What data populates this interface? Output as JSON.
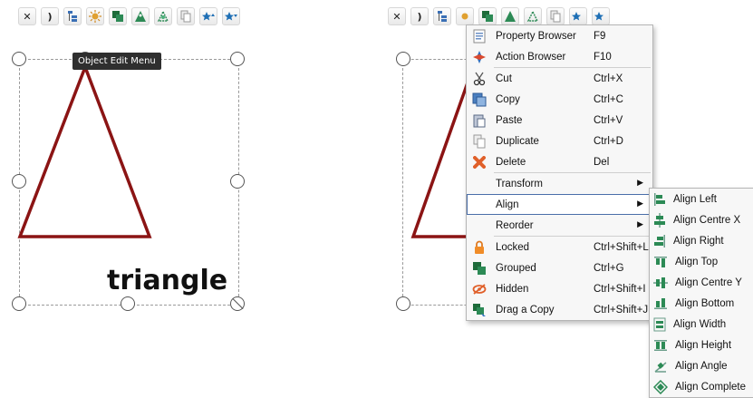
{
  "toolbar_icons": [
    "fit-icon",
    "moon-icon",
    "tree-icon",
    "sun-icon",
    "group-icon",
    "shape-icon",
    "node-icon",
    "copy-icon",
    "star-up-icon",
    "star-down-icon"
  ],
  "toolbar_glyphs": {
    "fit": "✕",
    "moon": ")"
  },
  "tooltip": "Object Edit Menu",
  "shape_label": "triangle",
  "colors": {
    "triangle": "#8b1414",
    "accent": "#4a6ea9",
    "tooltip_bg": "#2f2f2f"
  },
  "menu": {
    "items": [
      {
        "label": "Property Browser",
        "shortcut": "F9",
        "icon": "property-browser-icon"
      },
      {
        "label": "Action Browser",
        "shortcut": "F10",
        "icon": "action-browser-icon"
      },
      {
        "label": "Cut",
        "shortcut": "Ctrl+X",
        "icon": "cut-icon"
      },
      {
        "label": "Copy",
        "shortcut": "Ctrl+C",
        "icon": "copy-icon"
      },
      {
        "label": "Paste",
        "shortcut": "Ctrl+V",
        "icon": "paste-icon"
      },
      {
        "label": "Duplicate",
        "shortcut": "Ctrl+D",
        "icon": "duplicate-icon"
      },
      {
        "label": "Delete",
        "shortcut": "Del",
        "icon": "delete-icon"
      },
      {
        "label": "Transform",
        "shortcut": "",
        "icon": ""
      },
      {
        "label": "Align",
        "shortcut": "",
        "icon": ""
      },
      {
        "label": "Reorder",
        "shortcut": "",
        "icon": ""
      },
      {
        "label": "Locked",
        "shortcut": "Ctrl+Shift+L",
        "icon": "lock-icon"
      },
      {
        "label": "Grouped",
        "shortcut": "Ctrl+G",
        "icon": "group-icon"
      },
      {
        "label": "Hidden",
        "shortcut": "Ctrl+Shift+I",
        "icon": "hidden-icon"
      },
      {
        "label": "Drag a Copy",
        "shortcut": "Ctrl+Shift+J",
        "icon": "drag-copy-icon"
      }
    ],
    "submenu_arrow": "▶",
    "highlighted": "Align"
  },
  "align_submenu": [
    {
      "label": "Align Left",
      "icon": "align-left-icon"
    },
    {
      "label": "Align Centre X",
      "icon": "align-centre-x-icon"
    },
    {
      "label": "Align Right",
      "icon": "align-right-icon"
    },
    {
      "label": "Align Top",
      "icon": "align-top-icon"
    },
    {
      "label": "Align Centre Y",
      "icon": "align-centre-y-icon"
    },
    {
      "label": "Align Bottom",
      "icon": "align-bottom-icon"
    },
    {
      "label": "Align Width",
      "icon": "align-width-icon"
    },
    {
      "label": "Align Height",
      "icon": "align-height-icon"
    },
    {
      "label": "Align Angle",
      "icon": "align-angle-icon"
    },
    {
      "label": "Align Complete",
      "icon": "align-complete-icon"
    }
  ]
}
